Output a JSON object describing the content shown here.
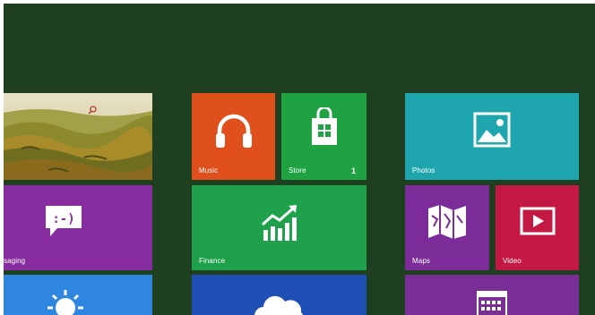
{
  "tiles": {
    "desktop": {
      "icon": "search-icon"
    },
    "music": {
      "label": "Music",
      "icon": "headphones-icon",
      "color": "#e0501d"
    },
    "store": {
      "label": "Store",
      "badge": "1",
      "icon": "shopping-bag-icon",
      "color": "#1ea242"
    },
    "photos": {
      "label": "Photos",
      "icon": "picture-icon",
      "color": "#1fa5ad"
    },
    "messaging": {
      "label": "saging",
      "icon": "chat-bubble-icon",
      "color": "#882d9f"
    },
    "finance": {
      "label": "Finance",
      "icon": "chart-up-icon",
      "color": "#1ea14a"
    },
    "maps": {
      "label": "Maps",
      "icon": "map-icon",
      "color": "#7b2c98"
    },
    "video": {
      "label": "Video",
      "icon": "play-icon",
      "color": "#c31843"
    },
    "weather": {
      "icon": "sun-icon",
      "color": "#2f86df"
    },
    "skydrive": {
      "icon": "cloud-icon",
      "color": "#1e4fb5"
    },
    "calendar": {
      "icon": "calendar-icon",
      "color": "#7a2f97"
    }
  },
  "colors": {
    "background": "#1f3f21"
  }
}
